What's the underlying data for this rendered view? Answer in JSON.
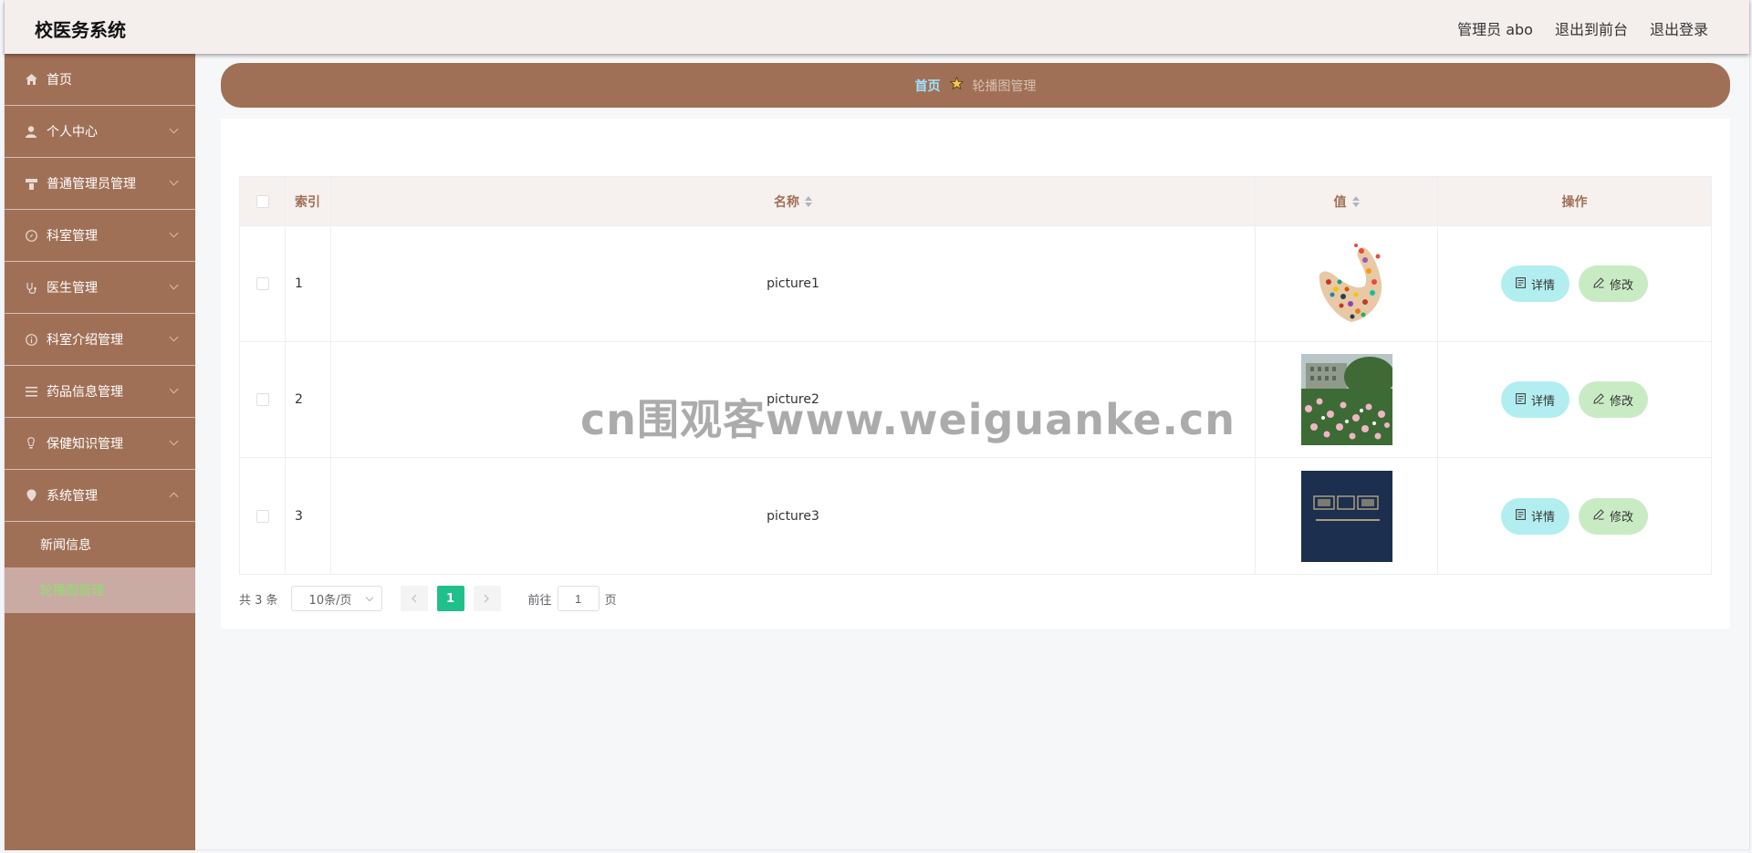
{
  "app": {
    "title": "校医务系统"
  },
  "topbar": {
    "user": "管理员 abo",
    "to_front": "退出到前台",
    "logout": "退出登录"
  },
  "sidebar": {
    "items": [
      {
        "label": "首页",
        "icon": "home-icon"
      },
      {
        "label": "个人中心",
        "icon": "user-icon"
      },
      {
        "label": "普通管理员管理",
        "icon": "admin-icon"
      },
      {
        "label": "科室管理",
        "icon": "compass-icon"
      },
      {
        "label": "医生管理",
        "icon": "doctor-icon"
      },
      {
        "label": "科室介绍管理",
        "icon": "info-icon"
      },
      {
        "label": "药品信息管理",
        "icon": "list-icon"
      },
      {
        "label": "保健知识管理",
        "icon": "bulb-icon"
      },
      {
        "label": "系统管理",
        "icon": "location-icon"
      }
    ],
    "subitems": [
      {
        "label": "新闻信息"
      },
      {
        "label": "轮播图管理",
        "active": true
      }
    ]
  },
  "breadcrumb": {
    "home": "首页",
    "current": "轮播图管理"
  },
  "table": {
    "columns": {
      "index": "索引",
      "name": "名称",
      "value": "值",
      "ops": "操作"
    },
    "rows": [
      {
        "index": "1",
        "name": "picture1"
      },
      {
        "index": "2",
        "name": "picture2"
      },
      {
        "index": "3",
        "name": "picture3"
      }
    ],
    "detail_label": "详情",
    "edit_label": "修改"
  },
  "pager": {
    "total": "共 3 条",
    "page_size": "10条/页",
    "current": "1",
    "goto": "前往",
    "goto_value": "1",
    "page_unit": "页"
  },
  "watermark": "cn围观客www.weiguanke.cn",
  "colors": {
    "sidebar": "#a07056",
    "accent_green": "#20c08a",
    "detail_btn": "#b2eef0",
    "edit_btn": "#c9ebc4"
  }
}
